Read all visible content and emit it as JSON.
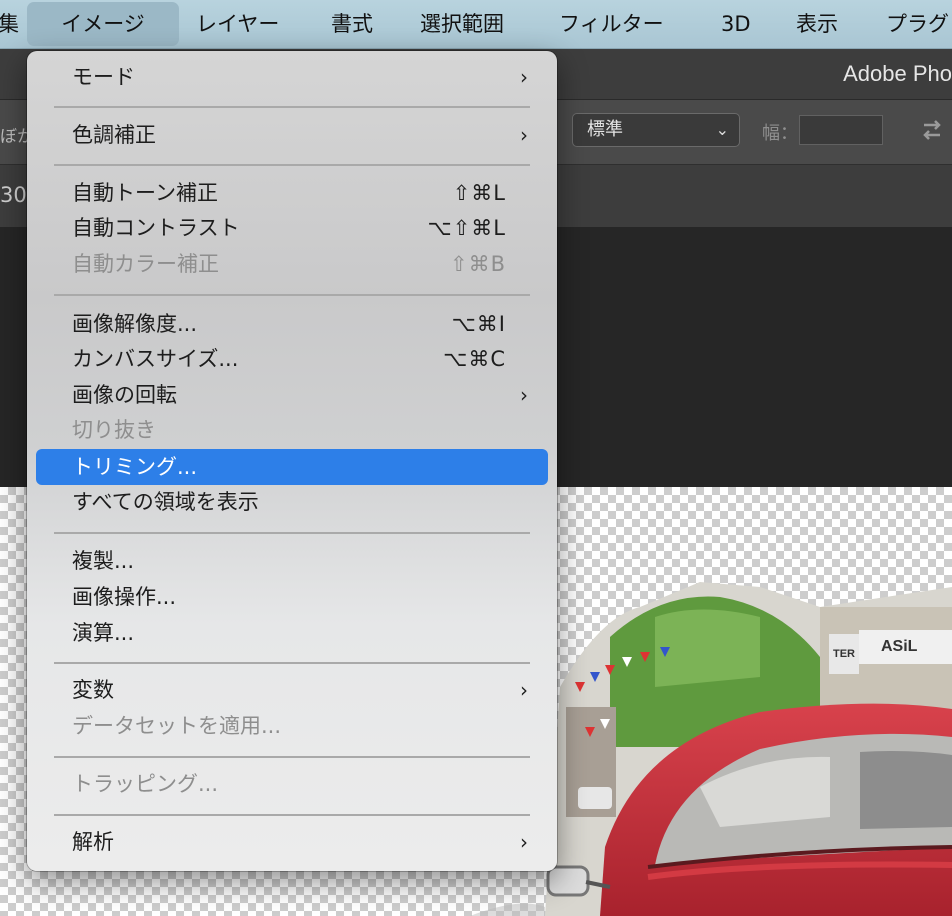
{
  "menubar": {
    "items": [
      {
        "label": "集"
      },
      {
        "label": "イメージ"
      },
      {
        "label": "レイヤー"
      },
      {
        "label": "書式"
      },
      {
        "label": "選択範囲"
      },
      {
        "label": "フィルター"
      },
      {
        "label": "3D"
      },
      {
        "label": "表示"
      },
      {
        "label": "プラグ"
      }
    ]
  },
  "app": {
    "title": "Adobe Pho"
  },
  "options_bar": {
    "left_fragment": "ぼか",
    "style_select": {
      "value": "標準"
    },
    "width_label": "幅：",
    "width_value": ""
  },
  "tab_bar": {
    "fragment": "30."
  },
  "image_menu": {
    "items": [
      {
        "label": "モード",
        "submenu": "›"
      },
      {
        "label": "色調補正",
        "submenu": "›"
      },
      {
        "label": "自動トーン補正",
        "shortcut": "⇧⌘L"
      },
      {
        "label": "自動コントラスト",
        "shortcut": "⌥⇧⌘L"
      },
      {
        "label": "自動カラー補正",
        "shortcut": "⇧⌘B"
      },
      {
        "label": "画像解像度...",
        "shortcut": "⌥⌘I"
      },
      {
        "label": "カンバスサイズ...",
        "shortcut": "⌥⌘C"
      },
      {
        "label": "画像の回転",
        "submenu": "›"
      },
      {
        "label": "切り抜き"
      },
      {
        "label": "トリミング..."
      },
      {
        "label": "すべての領域を表示"
      },
      {
        "label": "複製..."
      },
      {
        "label": "画像操作..."
      },
      {
        "label": "演算..."
      },
      {
        "label": "変数",
        "submenu": "›"
      },
      {
        "label": "データセットを適用..."
      },
      {
        "label": "トラッピング..."
      },
      {
        "label": "解析",
        "submenu": "›"
      }
    ]
  },
  "canvas": {
    "signs": {
      "asil": "ASiL",
      "ter": "TER"
    }
  },
  "colors": {
    "menubar_bg": "#aecbd8",
    "selection_highlight": "#2d7fe8",
    "car_red": "#c8303b",
    "sky_green": "#5f9a3e"
  }
}
